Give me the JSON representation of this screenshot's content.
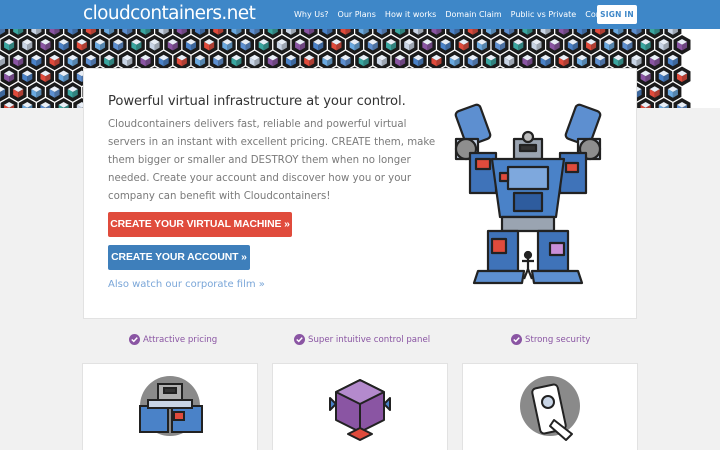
{
  "brand": "cloudcontainers.net",
  "nav": {
    "links": [
      "Why Us?",
      "Our Plans",
      "How it works",
      "Domain Claim",
      "Public vs Private",
      "Contact Us"
    ],
    "signin": "SIGN IN"
  },
  "hero": {
    "title": "Powerful virtual infrastructure at your control.",
    "text": "Cloudcontainers delivers fast, reliable and powerful virtual servers in an instant with excellent pricing. CREATE them, make them bigger or smaller and DESTROY them when no longer needed. Create your account and discover how you or your company can benefit with Cloudcontainers!",
    "cta_vm": "CREATE YOUR VIRTUAL MACHINE »",
    "cta_account": "CREATE YOUR ACCOUNT »",
    "film_link": "Also watch our corporate film »"
  },
  "features": [
    "Attractive pricing",
    "Super intuitive control panel",
    "Strong security"
  ],
  "colors": {
    "navbar": "#3e87c8",
    "red": "#e04b3c",
    "blue": "#3e7fbb",
    "purple": "#8a55a3"
  },
  "icons": [
    "check-circle-icon",
    "robot-illustration",
    "cube-illustration",
    "phone-illustration"
  ]
}
